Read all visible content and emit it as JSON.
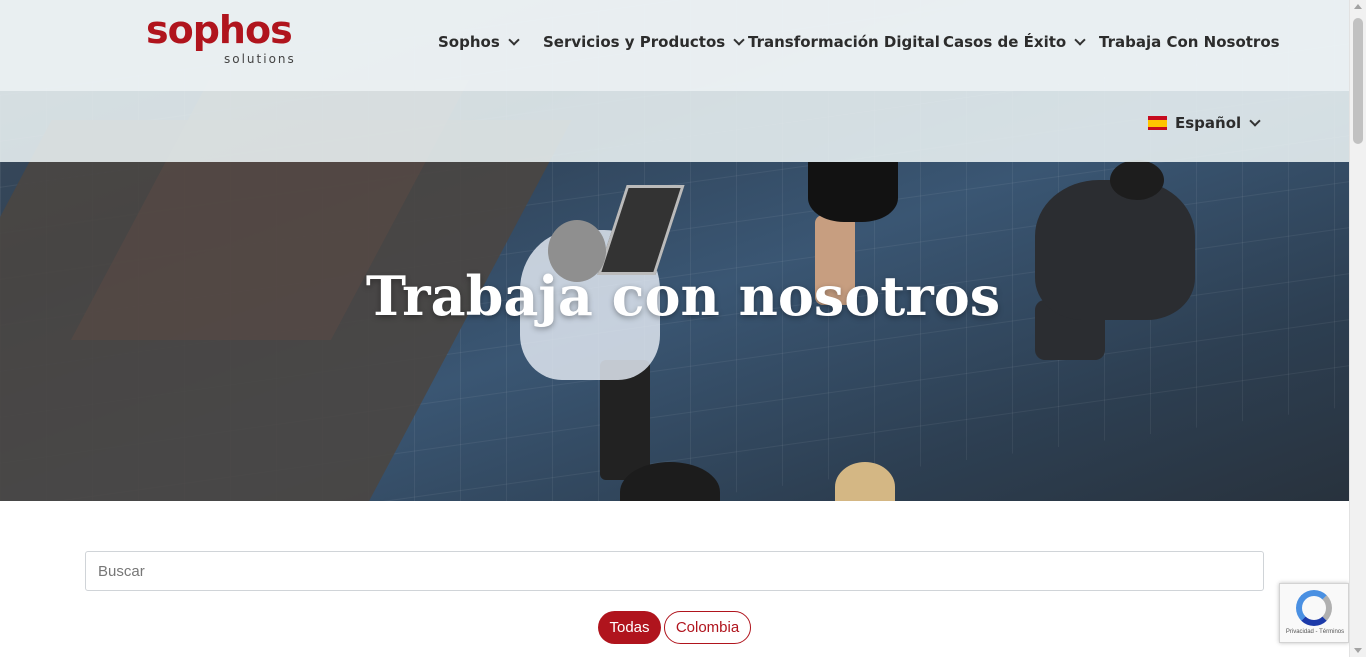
{
  "brand": {
    "logo_main": "sophos",
    "logo_sub": "solutions",
    "color": "#b0141d"
  },
  "nav": {
    "items": [
      {
        "label": "Sophos",
        "has_dropdown": true
      },
      {
        "label": "Servicios y Productos",
        "has_dropdown": true
      },
      {
        "label": "Transformación Digital",
        "has_dropdown": false
      },
      {
        "label": "Casos de Éxito",
        "has_dropdown": true
      },
      {
        "label": "Trabaja Con Nosotros",
        "has_dropdown": false
      }
    ]
  },
  "language": {
    "label": "Español",
    "flag_icon": "spain-flag-icon"
  },
  "hero": {
    "title": "Trabaja con nosotros"
  },
  "search": {
    "placeholder": "Buscar",
    "value": ""
  },
  "filters": [
    {
      "label": "Todas",
      "active": true
    },
    {
      "label": "Colombia",
      "active": false
    }
  ],
  "recaptcha": {
    "text": "Privacidad - Términos"
  }
}
